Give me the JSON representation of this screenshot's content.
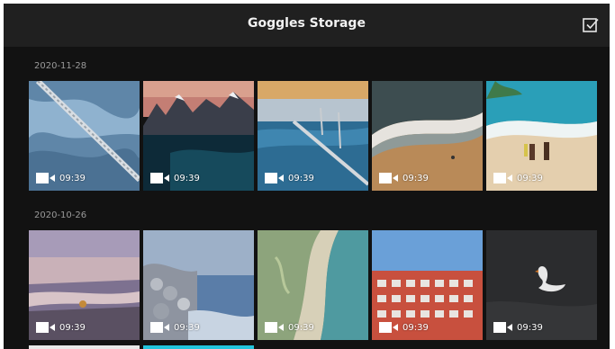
{
  "header": {
    "title": "Goggles Storage",
    "select_icon": "checkbox-icon"
  },
  "sections": [
    {
      "date": "2020-11-28",
      "items": [
        {
          "duration": "09:39",
          "media": "video",
          "scene": "aerial river delta with bridge",
          "selected": true
        },
        {
          "duration": "09:39",
          "media": "video",
          "scene": "snowy mountains over lake"
        },
        {
          "duration": "09:39",
          "media": "video",
          "scene": "long sea bridge at sunset"
        },
        {
          "duration": "09:39",
          "media": "video",
          "scene": "waves on sandy beach aerial"
        },
        {
          "duration": "09:39",
          "media": "video",
          "scene": "surfers walking on beach"
        }
      ]
    },
    {
      "date": "2020-10-26",
      "items": [
        {
          "duration": "09:39",
          "media": "video",
          "scene": "purple sky lake shore"
        },
        {
          "duration": "09:39",
          "media": "video",
          "scene": "rocky coastline in mist"
        },
        {
          "duration": "09:39",
          "media": "video",
          "scene": "green aerial coastline"
        },
        {
          "duration": "09:39",
          "media": "video",
          "scene": "red apartment building"
        },
        {
          "duration": "09:39",
          "media": "video",
          "scene": "white swan on dark water"
        }
      ]
    }
  ],
  "colors": {
    "background": "#121212",
    "header": "#202020",
    "selection_outline": "#d9a21b"
  }
}
